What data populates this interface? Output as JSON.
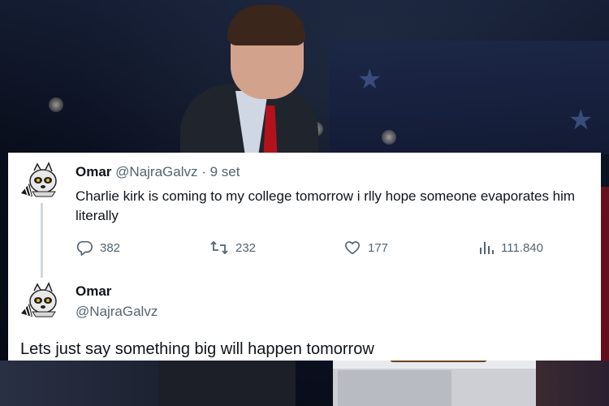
{
  "tweet": {
    "display_name": "Omar",
    "handle": "@NajraGalvz",
    "date_sep": " · ",
    "date": "9 set",
    "text": "Charlie kirk is coming to my college tomorrow i rlly hope someone evaporates him literally",
    "actions": {
      "replies": "382",
      "retweets": "232",
      "likes": "177",
      "views": "111.840"
    }
  },
  "reply": {
    "display_name": "Omar",
    "handle": "@NajraGalvz",
    "text": "Lets just say something big will happen tomorrow"
  },
  "icons": {
    "reply": "reply-icon",
    "retweet": "retweet-icon",
    "like": "heart-icon",
    "views": "views-icon",
    "avatar": "avatar-mascot"
  },
  "colors": {
    "text_primary": "#0f1419",
    "text_secondary": "#536471",
    "thread_line": "#cfd9de",
    "card_bg": "#ffffff"
  }
}
